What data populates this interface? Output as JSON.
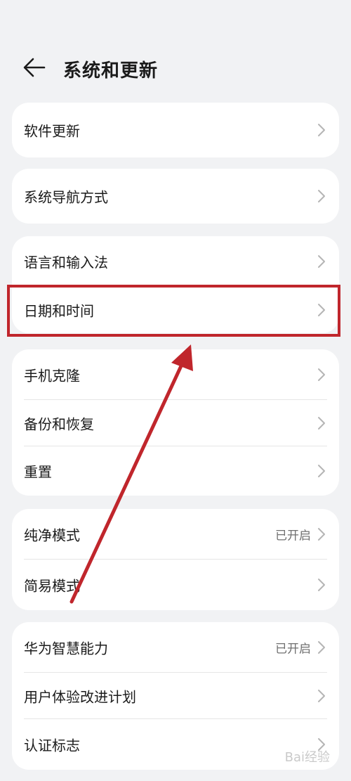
{
  "header": {
    "title": "系统和更新",
    "back_icon": "arrow-left-icon"
  },
  "cards": [
    {
      "rows": [
        {
          "label": "软件更新",
          "status": ""
        }
      ]
    },
    {
      "rows": [
        {
          "label": "系统导航方式",
          "status": ""
        }
      ]
    },
    {
      "rows": [
        {
          "label": "语言和输入法",
          "status": ""
        },
        {
          "label": "日期和时间",
          "status": ""
        }
      ]
    },
    {
      "rows": [
        {
          "label": "手机克隆",
          "status": ""
        },
        {
          "label": "备份和恢复",
          "status": ""
        },
        {
          "label": "重置",
          "status": ""
        }
      ]
    },
    {
      "rows": [
        {
          "label": "纯净模式",
          "status": "已开启"
        },
        {
          "label": "简易模式",
          "status": ""
        }
      ]
    },
    {
      "rows": [
        {
          "label": "华为智慧能力",
          "status": "已开启"
        },
        {
          "label": "用户体验改进计划",
          "status": ""
        },
        {
          "label": "认证标志",
          "status": ""
        }
      ]
    }
  ],
  "annotation": {
    "highlight_color": "#c0262c",
    "highlighted_item": "日期和时间"
  },
  "watermark": {
    "text": "Bai经验"
  },
  "colors": {
    "background": "#f1f2f4",
    "card": "#ffffff",
    "text": "#1b1b1b",
    "secondary_text": "#6f6f6f"
  }
}
